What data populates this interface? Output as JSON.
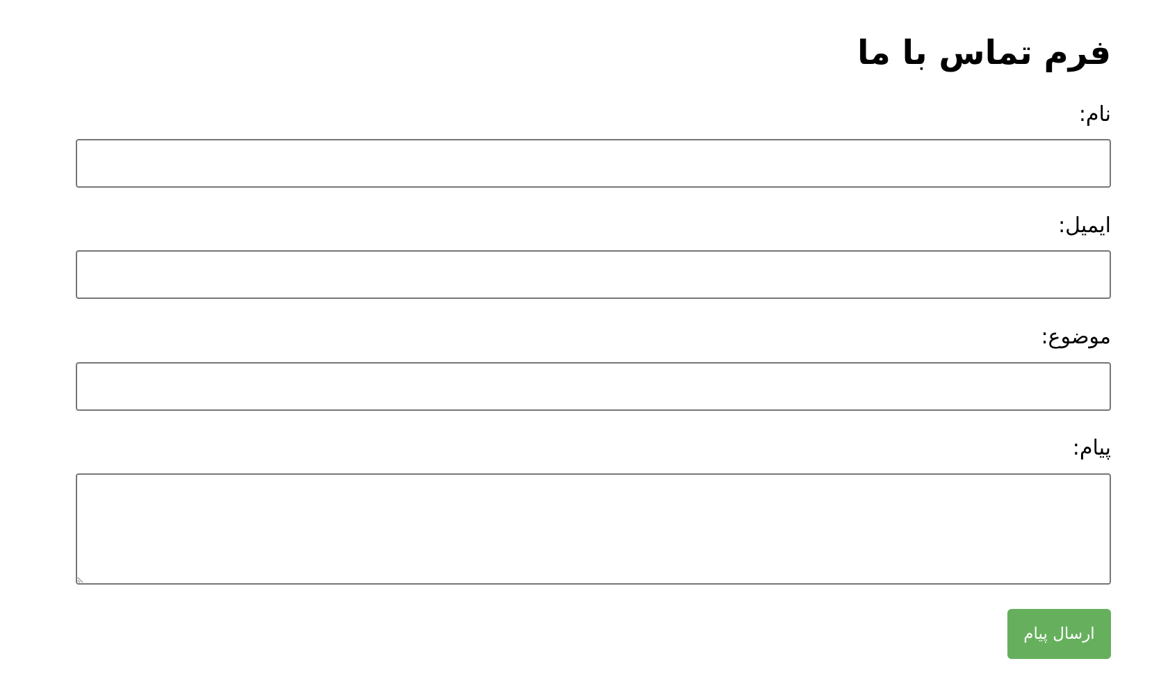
{
  "form": {
    "title": "فرم تماس با ما",
    "fields": [
      {
        "label": "نام:",
        "value": "",
        "type": "text"
      },
      {
        "label": "ایمیل:",
        "value": "",
        "type": "email"
      },
      {
        "label": "موضوع:",
        "value": "",
        "type": "text"
      },
      {
        "label": "پیام:",
        "value": "",
        "type": "textarea"
      }
    ],
    "submit_label": "ارسال پیام"
  },
  "colors": {
    "submit_button_bg": "#66b05d",
    "input_border": "#767676"
  }
}
